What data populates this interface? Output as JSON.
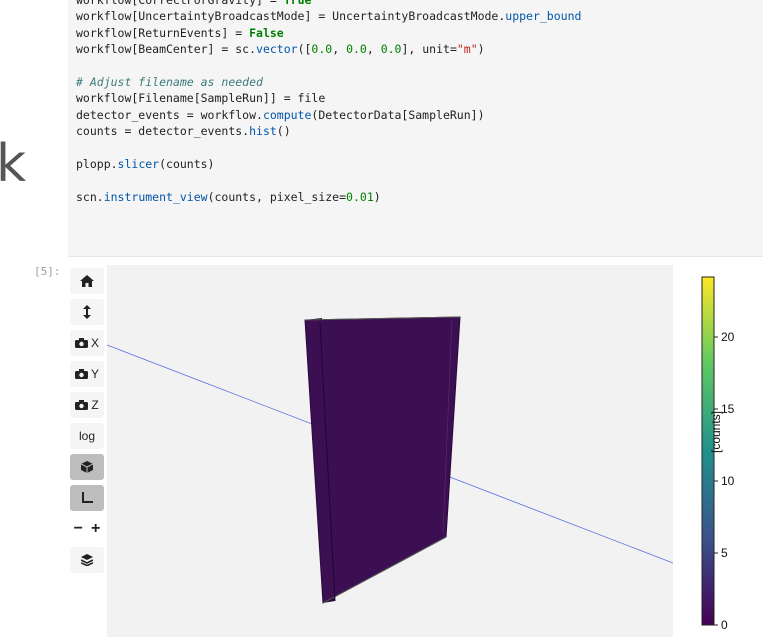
{
  "left_edge_text": "k",
  "code_cell": {
    "lines": [
      [
        [
          "workflow[CorrectForGravity] = ",
          "",
          "true_partial"
        ],
        [
          "True",
          "kw"
        ]
      ],
      [
        [
          "workflow[UncertaintyBroadcastMode] = UncertaintyBroadcastMode.",
          ""
        ],
        [
          "upper_bound",
          "attr"
        ]
      ],
      [
        [
          "workflow[ReturnEvents] = ",
          ""
        ],
        [
          "False",
          "kw"
        ]
      ],
      [
        [
          "workflow[BeamCenter] = sc.",
          ""
        ],
        [
          "vector",
          "attr"
        ],
        [
          "([",
          ""
        ],
        [
          "0.0",
          "num"
        ],
        [
          ", ",
          ""
        ],
        [
          "0.0",
          "num"
        ],
        [
          ", ",
          ""
        ],
        [
          "0.0",
          "num"
        ],
        [
          "], unit=",
          ""
        ],
        [
          "\"m\"",
          "str"
        ],
        [
          ")",
          ""
        ]
      ],
      [
        [
          "",
          ""
        ]
      ],
      [
        [
          "# Adjust filename as needed",
          "comment"
        ]
      ],
      [
        [
          "workflow[Filename[SampleRun]] = file",
          ""
        ]
      ],
      [
        [
          "detector_events = workflow.",
          ""
        ],
        [
          "compute",
          "attr"
        ],
        [
          "(DetectorData[SampleRun])",
          ""
        ]
      ],
      [
        [
          "counts = detector_events.",
          ""
        ],
        [
          "hist",
          "attr"
        ],
        [
          "()",
          ""
        ]
      ],
      [
        [
          "",
          ""
        ]
      ],
      [
        [
          "plopp.",
          ""
        ],
        [
          "slicer",
          "attr"
        ],
        [
          "(counts)",
          ""
        ]
      ],
      [
        [
          "",
          ""
        ]
      ],
      [
        [
          "scn.",
          ""
        ],
        [
          "instrument_view",
          "attr"
        ],
        [
          "(counts, pixel_size=",
          ""
        ],
        [
          "0.01",
          "num"
        ],
        [
          ")",
          ""
        ]
      ]
    ]
  },
  "output_prompt": "[5]:",
  "toolbar": {
    "buttons": [
      {
        "name": "home-button",
        "icon": "home-icon",
        "label": ""
      },
      {
        "name": "camera-reset-button",
        "icon": "vertical-arrows-icon",
        "label": ""
      },
      {
        "name": "camera-x-button",
        "icon": "camera-icon",
        "label": "X"
      },
      {
        "name": "camera-y-button",
        "icon": "camera-icon",
        "label": "Y"
      },
      {
        "name": "camera-z-button",
        "icon": "camera-icon",
        "label": "Z"
      },
      {
        "name": "log-button",
        "icon": "",
        "label": "log"
      },
      {
        "name": "box-toggle-button",
        "icon": "cube-icon",
        "label": "",
        "active": true
      },
      {
        "name": "axes-toggle-button",
        "icon": "axes-icon",
        "label": "",
        "active": true
      },
      {
        "name": "size-buttons",
        "icon": "",
        "label": ""
      },
      {
        "name": "layers-button",
        "icon": "layers-icon",
        "label": ""
      }
    ],
    "minus_label": "−",
    "plus_label": "+"
  },
  "colorbar": {
    "label": "[counts]",
    "ticks": [
      "20",
      "15",
      "10",
      "5",
      "0"
    ],
    "colors": [
      "#fde725",
      "#5ec962",
      "#21918c",
      "#3b528b",
      "#440154"
    ]
  },
  "scene": {
    "panel_color": "#3b0f52",
    "line_color": "#5a6ee0"
  }
}
